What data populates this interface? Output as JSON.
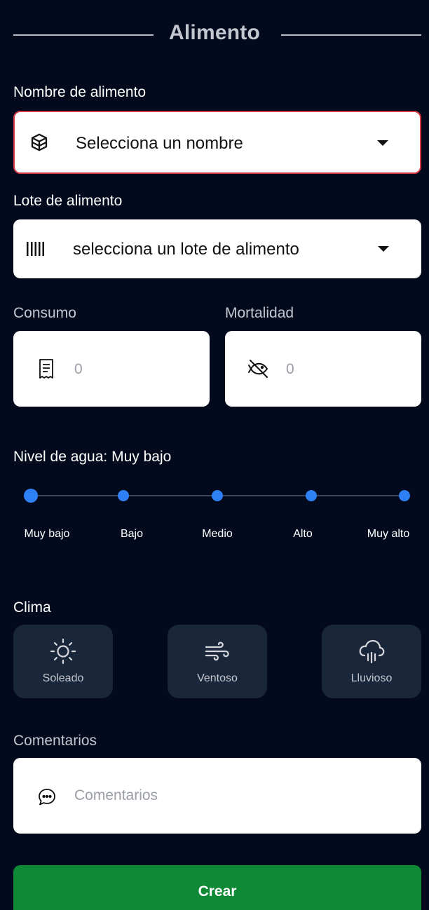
{
  "header": {
    "title": "Alimento"
  },
  "food_name": {
    "label": "Nombre de alimento",
    "value": "Selecciona un nombre",
    "icon": "package-icon"
  },
  "food_lot": {
    "label": "Lote de alimento",
    "value": "selecciona un lote de alimento",
    "icon": "barcode-icon"
  },
  "consumption": {
    "label": "Consumo",
    "placeholder": "0",
    "icon": "receipt-icon"
  },
  "mortality": {
    "label": "Mortalidad",
    "placeholder": "0",
    "icon": "fish-off-icon"
  },
  "water_level": {
    "label": "Nivel de agua: Muy bajo",
    "selected_index": 0,
    "stops": [
      "Muy bajo",
      "Bajo",
      "Medio",
      "Alto",
      "Muy alto"
    ],
    "accent": "#2f7ff5"
  },
  "climate": {
    "label": "Clima",
    "options": [
      {
        "label": "Soleado",
        "icon": "sun-icon"
      },
      {
        "label": "Ventoso",
        "icon": "wind-icon"
      },
      {
        "label": "Lluvioso",
        "icon": "rain-icon"
      }
    ]
  },
  "comments": {
    "label": "Comentarios",
    "placeholder": "Comentarios",
    "icon": "chat-icon"
  },
  "actions": {
    "create_label": "Crear",
    "create_color": "#0e8a36"
  },
  "colors": {
    "background": "#030a1d",
    "error_border": "#d33b46",
    "chip_bg": "#1a273a"
  }
}
